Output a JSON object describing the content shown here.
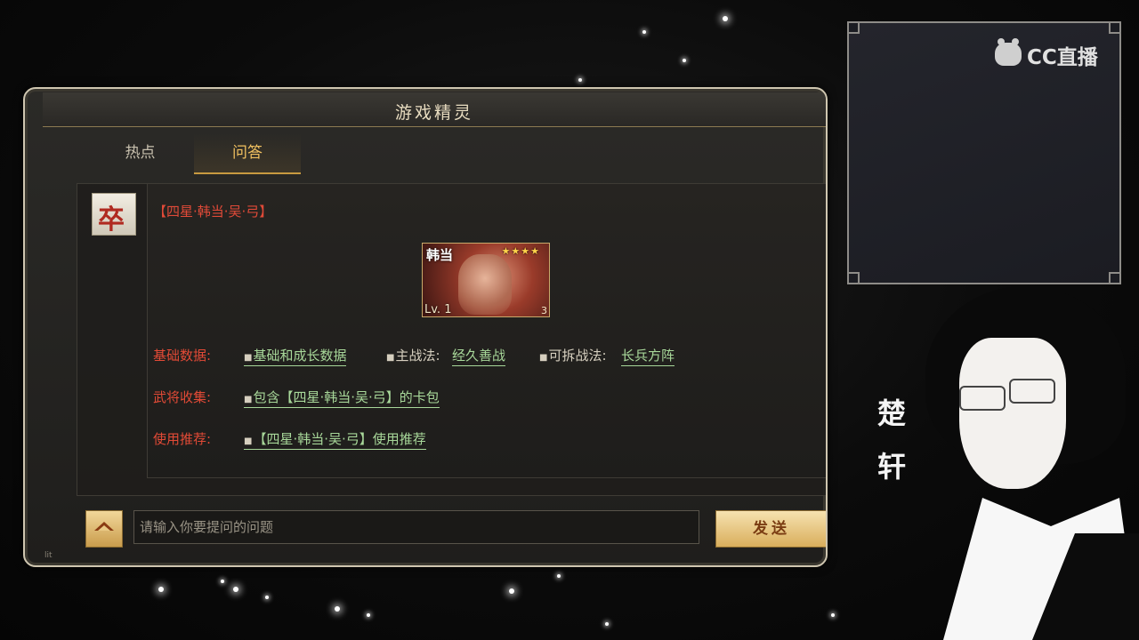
{
  "window": {
    "title": "游戏精灵",
    "tabs": [
      {
        "label": "热点",
        "active": false
      },
      {
        "label": "问答",
        "active": true
      }
    ]
  },
  "message": {
    "avatar_char": "卒",
    "title": "【四星·韩当·吴·弓】",
    "card": {
      "name": "韩当",
      "stars": "★★★★",
      "level": "Lv. 1",
      "badge": "3"
    },
    "rows": [
      {
        "label": "基础数据:",
        "items": [
          {
            "text": "基础和成长数据",
            "type": "link"
          },
          {
            "text": "主战法:",
            "type": "plain"
          },
          {
            "text": "经久善战",
            "type": "link"
          },
          {
            "text": "可拆战法:",
            "type": "plain"
          },
          {
            "text": "长兵方阵",
            "type": "link"
          }
        ]
      },
      {
        "label": "武将收集:",
        "items": [
          {
            "text": "包含【四星·韩当·吴·弓】的卡包",
            "type": "link"
          }
        ]
      },
      {
        "label": "使用推荐:",
        "items": [
          {
            "text": "【四星·韩当·吴·弓】使用推荐",
            "type": "link"
          }
        ]
      }
    ]
  },
  "input": {
    "placeholder": "请输入你要提问的问题",
    "send_label": "发送",
    "corner_mark": "lit"
  },
  "overlay": {
    "brand": "CC直播",
    "streamer_name_1": "楚",
    "streamer_name_2": "轩"
  },
  "colors": {
    "accent_gold": "#c89a40",
    "label_red": "#e24a36",
    "link_green": "#a8d89a"
  }
}
